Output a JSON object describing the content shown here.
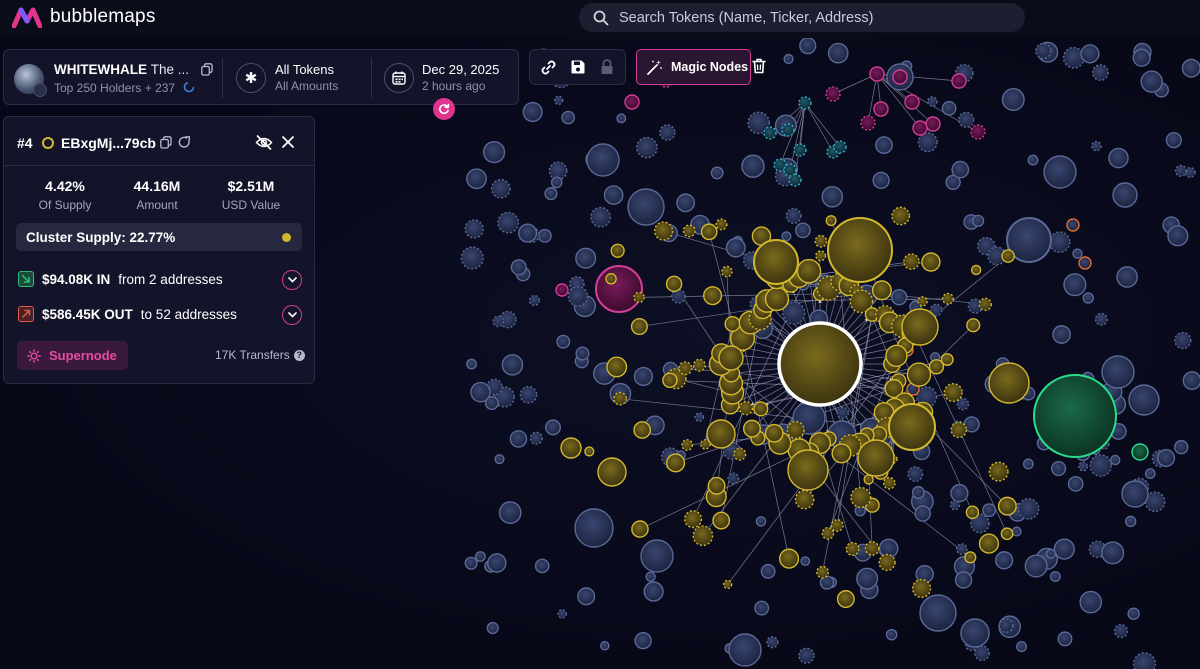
{
  "app": {
    "name": "bubblemaps"
  },
  "search": {
    "placeholder": "Search Tokens (Name, Ticker, Address)"
  },
  "token": {
    "symbol": "WHITEWHALE",
    "name_truncated": "The ...",
    "holders_label": "Top 250 Holders + 237"
  },
  "filter": {
    "title": "All Tokens",
    "subtitle": "All Amounts"
  },
  "snapshot": {
    "date": "Dec 29, 2025",
    "relative": "2 hours ago"
  },
  "toolbar": {
    "magic_nodes_label": "Magic Nodes"
  },
  "selected": {
    "rank": "#4",
    "address": "EBxgMj...79cb",
    "stats": [
      {
        "value": "4.42%",
        "label": "Of Supply"
      },
      {
        "value": "44.16M",
        "label": "Amount"
      },
      {
        "value": "$2.51M",
        "label": "USD Value"
      }
    ],
    "cluster_supply": "Cluster Supply: 22.77%",
    "inflow": {
      "amount": "$94.08K IN",
      "detail": "from 2 addresses"
    },
    "outflow": {
      "amount": "$586.45K OUT",
      "detail": "to 52 addresses"
    },
    "supernode_label": "Supernode",
    "transfers": "17K Transfers"
  },
  "colors": {
    "accent_pink": "#d43d98",
    "cluster_yellow": "#d3b82e",
    "node_blue": "#2b3556",
    "node_teal": "#2a8aa0",
    "node_magenta": "#c42b9a",
    "node_green": "#2bbf7a",
    "node_orange": "#e06a2a",
    "background": "#070818"
  }
}
